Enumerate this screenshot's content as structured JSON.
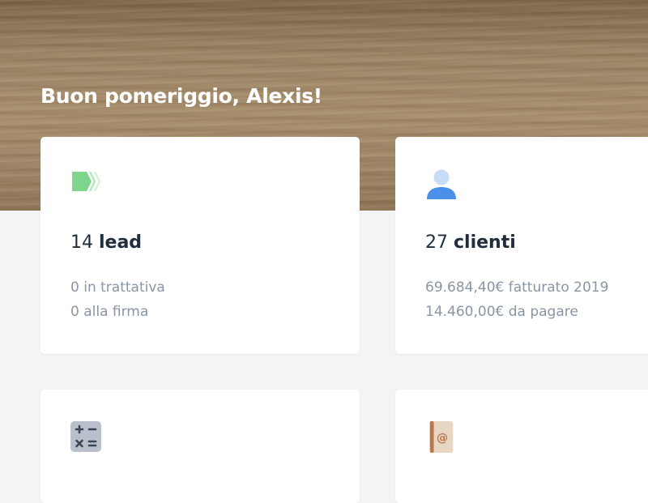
{
  "header": {
    "greeting": "Buon pomeriggio, Alexis!"
  },
  "cards": [
    {
      "icon": "lead-tag-icon",
      "count": "14",
      "label": "lead",
      "lines": [
        "0 in trattativa",
        "0 alla firma"
      ]
    },
    {
      "icon": "user-icon",
      "count": "27",
      "label": "clienti",
      "lines": [
        "69.684,40€ fatturato 2019",
        "14.460,00€ da pagare"
      ]
    },
    {
      "icon": "calculator-icon"
    },
    {
      "icon": "address-book-icon"
    }
  ],
  "colors": {
    "lead_icon": "#7ed58b",
    "user_icon_body": "#4a90e8",
    "user_icon_head": "#c7dcf7",
    "calculator_icon": "#b9c0cb",
    "address_book_icon": "#e8d6c4",
    "title_text": "#1f2d3d",
    "secondary_text": "#8a95a3",
    "page_background": "#f3f4f6"
  }
}
